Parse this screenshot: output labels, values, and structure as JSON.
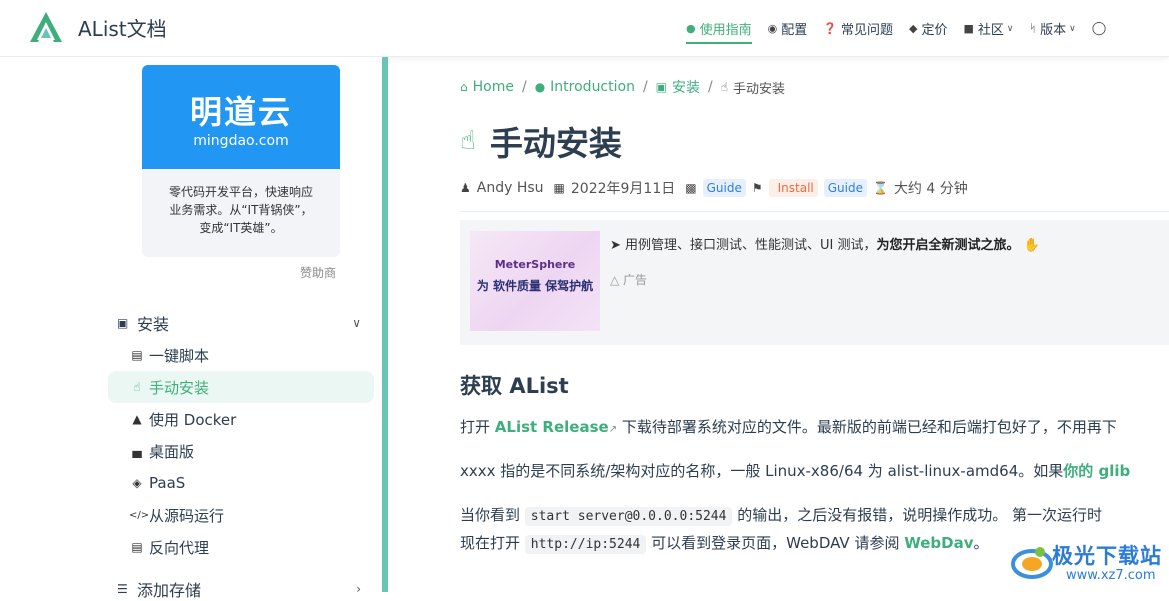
{
  "brand": {
    "title": "AList文档"
  },
  "colors": {
    "accent": "#3eaf7c",
    "sidebar_divider": "#68c4b4",
    "sponsor_blue": "#2196f3"
  },
  "nav": [
    {
      "label": "使用指南",
      "icon": "lightbulb-icon",
      "active": true
    },
    {
      "label": "配置",
      "icon": "compass-icon"
    },
    {
      "label": "常见问题",
      "icon": "question-circle-icon"
    },
    {
      "label": "定价",
      "icon": "eraser-icon"
    },
    {
      "label": "社区",
      "icon": "chat-icon",
      "dropdown": true
    },
    {
      "label": "版本",
      "icon": "branch-icon",
      "dropdown": true
    }
  ],
  "sponsor": {
    "logo_main": "明道云",
    "logo_sub": "mingdao.com",
    "line1": "零代码开发平台，快速响应",
    "line2": "业务需求。从“IT背锅侠”，",
    "line3": "变成“IT英雄”。",
    "tag": "赞助商"
  },
  "sidebar": {
    "group1": {
      "label": "安装"
    },
    "items": [
      {
        "label": "一键脚本",
        "icon": "script-icon"
      },
      {
        "label": "手动安装",
        "icon": "hand-pointer-icon",
        "active": true
      },
      {
        "label": "使用 Docker",
        "icon": "docker-icon"
      },
      {
        "label": "桌面版",
        "icon": "monitor-icon"
      },
      {
        "label": "PaaS",
        "icon": "cube-icon"
      },
      {
        "label": "从源码运行",
        "icon": "code-icon"
      },
      {
        "label": "反向代理",
        "icon": "server-icon"
      }
    ],
    "group2": {
      "label": "添加存储"
    }
  },
  "breadcrumb": [
    {
      "label": "Home",
      "icon": "home-icon"
    },
    {
      "label": "Introduction",
      "icon": "lightbulb-icon"
    },
    {
      "label": "安装",
      "icon": "box-icon"
    },
    {
      "label": "手动安装",
      "icon": "hand-pointer-icon"
    }
  ],
  "page": {
    "title": "手动安装",
    "author": "Andy Hsu",
    "date": "2022年9月11日",
    "category": "Guide",
    "tags": [
      "Install",
      "Guide"
    ],
    "reading_time": "大约 4 分钟"
  },
  "ad": {
    "image_line1": "MeterSphere",
    "image_line2": "为 软件质量 保驾护航",
    "text_prefix": "用例管理、接口测试、性能测试、UI 测试，",
    "text_bold": "为您开启全新测试之旅。",
    "label": "广告"
  },
  "content": {
    "h2_bold": "获取",
    "h2_rest": "AList",
    "p1_before": "打开 ",
    "p1_link": "AList Release",
    "p1_after": " 下载待部署系统对应的文件。最新版的前端已经和后端打包好了，不用再下",
    "p2_before": "xxxx 指的是不同系统/架构对应的名称，一般 Linux-x86/64 为 alist-linux-amd64。如果",
    "p2_link": "你的 glib",
    "p3_before": "当你看到 ",
    "p3_code": "start server@0.0.0.0:5244",
    "p3_after": " 的输出，之后没有报错，说明操作成功。 第一次运行时",
    "p4_before": "现在打开 ",
    "p4_code": "http://ip:5244",
    "p4_mid": " 可以看到登录页面，WebDAV 请参阅 ",
    "p4_link": "WebDav",
    "p4_after": "。"
  },
  "watermark": {
    "name": "极光下载站",
    "url": "www.xz7.com"
  }
}
